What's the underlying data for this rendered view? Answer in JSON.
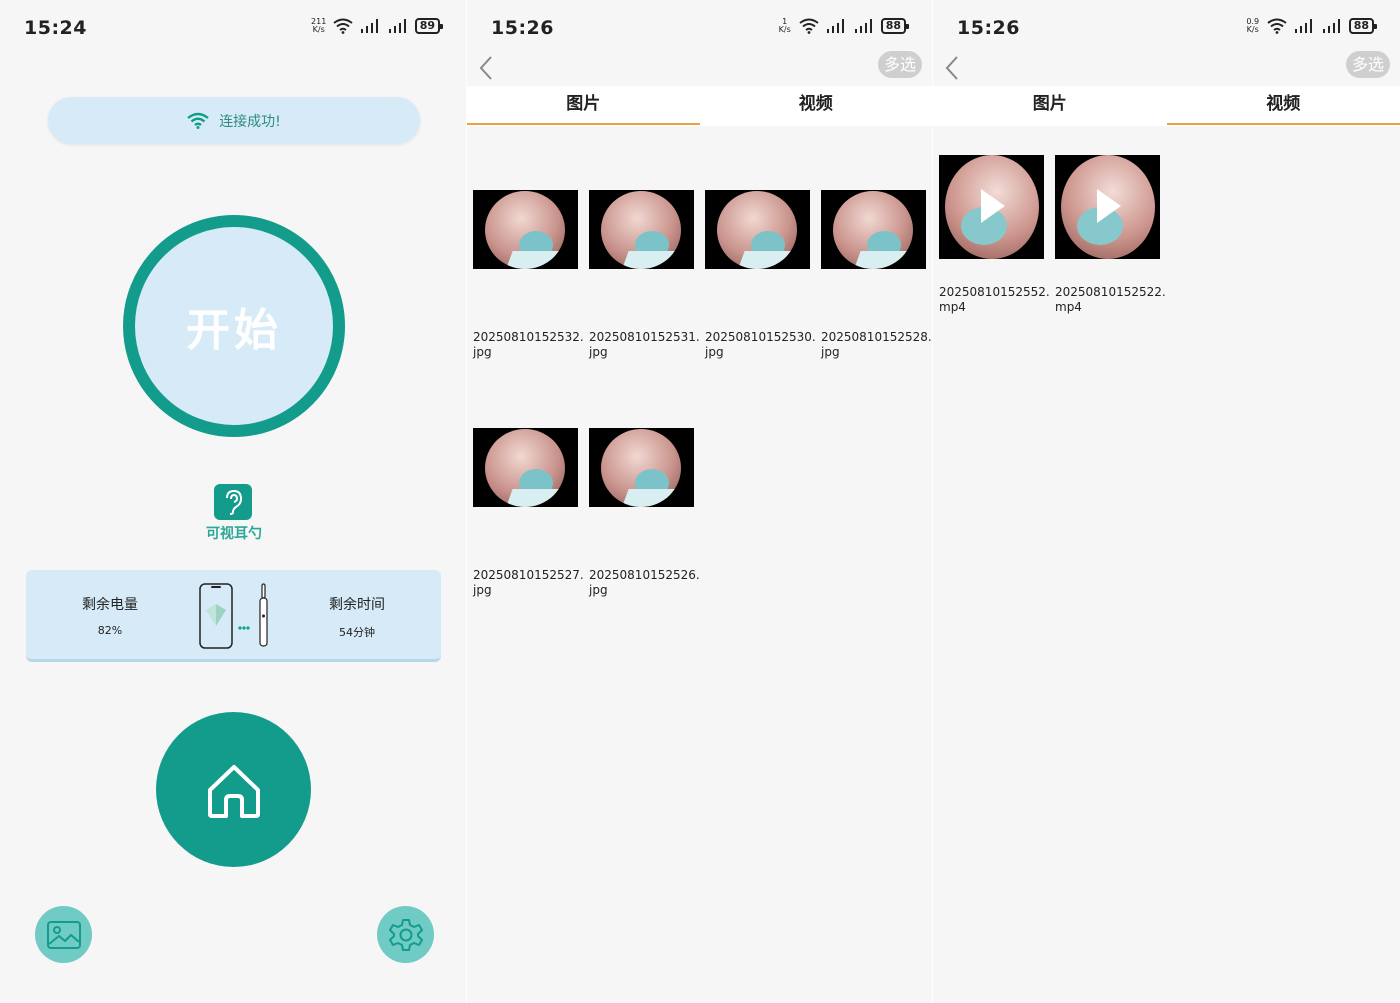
{
  "colors": {
    "teal": "#139c8c",
    "light_blue": "#d6ebf7",
    "tab_underline": "#e8a242"
  },
  "screen1": {
    "status": {
      "time": "15:24",
      "speed_num": "211",
      "speed_unit": "K/s",
      "battery": "89"
    },
    "connection_text": "连接成功!",
    "start_label": "开始",
    "device_label": "可视耳勺",
    "battery_title": "剩余电量",
    "battery_value": "82%",
    "time_title": "剩余时间",
    "time_value": "54分钟",
    "icons": {
      "wifi": "wifi-icon",
      "ear": "ear-icon",
      "home": "home-icon",
      "gallery": "gallery-icon",
      "settings": "gear-icon"
    }
  },
  "screen2": {
    "status": {
      "time": "15:26",
      "speed_num": "1",
      "speed_unit": "K/s",
      "battery": "88"
    },
    "multi_select": "多选",
    "tabs": [
      "图片",
      "视频"
    ],
    "active_tab": "图片",
    "photos": [
      "20250810152532.jpg",
      "20250810152531.jpg",
      "20250810152530.jpg",
      "20250810152528.jpg",
      "20250810152527.jpg",
      "20250810152526.jpg"
    ]
  },
  "screen3": {
    "status": {
      "time": "15:26",
      "speed_num": "0.9",
      "speed_unit": "K/s",
      "battery": "88"
    },
    "multi_select": "多选",
    "tabs": [
      "图片",
      "视频"
    ],
    "active_tab": "视频",
    "videos": [
      "20250810152552.mp4",
      "20250810152522.mp4"
    ]
  }
}
